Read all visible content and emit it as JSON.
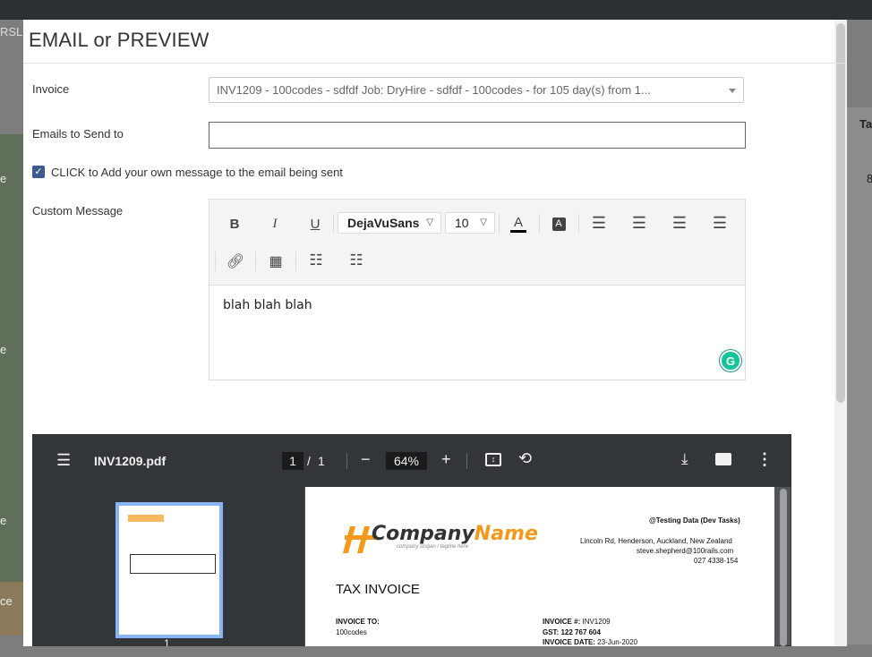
{
  "background": {
    "fragment_left": "RSL",
    "fragment_right": "Ta",
    "fragment_e": "e",
    "fragment_ce": "ce",
    "fragment_8": "8"
  },
  "modal": {
    "title": "EMAIL or PREVIEW",
    "invoice_label": "Invoice",
    "invoice_value": "INV1209 - 100codes - sdfdf Job: DryHire - sdfdf - 100codes - for 105 day(s) from 1...",
    "emails_label": "Emails to Send to",
    "emails_value": "",
    "checkbox_label": "CLICK to Add your own message to the email being sent",
    "checkbox_checked": true,
    "custom_message_label": "Custom Message"
  },
  "editor": {
    "font_family": "DejaVuSans",
    "font_size": "10",
    "content": "blah blah blah",
    "grammarly": "G"
  },
  "pdf": {
    "filename": "INV1209.pdf",
    "current_page": "1",
    "page_separator": "/",
    "total_pages": "1",
    "zoom": "64%",
    "thumbnail_label": "1",
    "document": {
      "company_a": "Company",
      "company_b": "Name",
      "slogan": "company slogan / tagline here",
      "header_right": "@Testing Data (Dev Tasks)",
      "address": "Lincoln Rd, Henderson, Auckland, New Zealand",
      "email": "steve.shepherd@100rails.com",
      "phone": "027 4338-154",
      "title": "TAX INVOICE",
      "invoice_to_label": "INVOICE TO:",
      "invoice_to_value": "100codes",
      "invoice_num_label": "INVOICE #:",
      "invoice_num_value": "INV1209",
      "gst_label": "GST:",
      "gst_value": "122 767 604",
      "invoice_date_label": "INVOICE DATE:",
      "invoice_date_value": "23-Jun-2020"
    }
  }
}
